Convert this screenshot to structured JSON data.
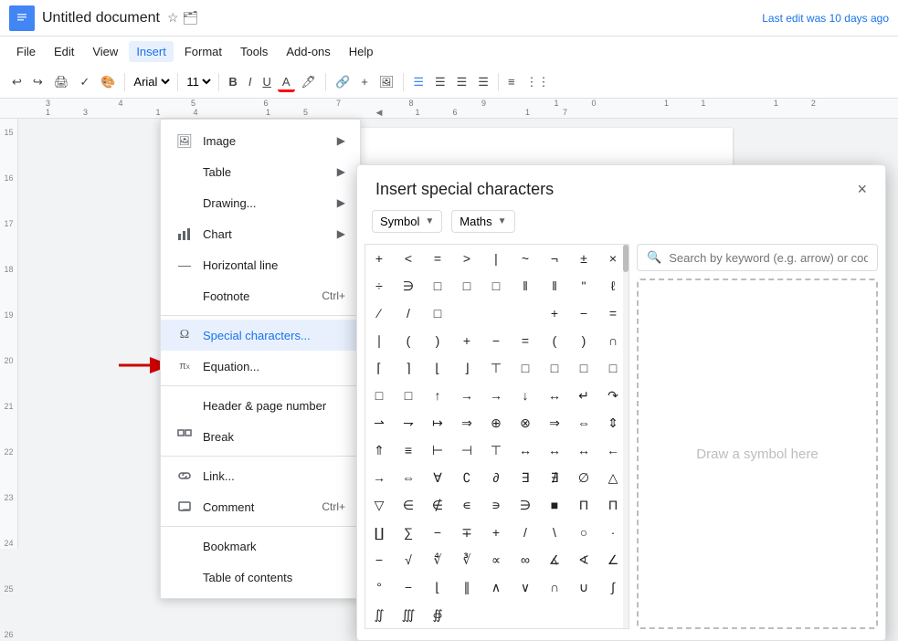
{
  "topbar": {
    "doc_icon": "📄",
    "title": "Untitled document",
    "star_icon": "☆",
    "folder_icon": "📁",
    "last_edit": "Last edit was 10 days ago"
  },
  "menubar": {
    "items": [
      "File",
      "Edit",
      "View",
      "Insert",
      "Format",
      "Tools",
      "Add-ons",
      "Help"
    ]
  },
  "toolbar": {
    "undo": "↩",
    "redo": "↪",
    "print": "🖨",
    "paint": "🎨",
    "font": "Arial",
    "font_size": "11",
    "bold": "B",
    "italic": "I",
    "underline": "U",
    "text_color": "A",
    "highlight": "🖊",
    "link": "🔗",
    "plus": "+",
    "image": "🖼"
  },
  "ruler": {
    "marks": [
      "3",
      "4",
      "5",
      "6",
      "7",
      "8",
      "9",
      "10",
      "11",
      "12",
      "13",
      "14",
      "15",
      "16",
      "17"
    ]
  },
  "sidebar": {
    "numbers": [
      "15",
      "16",
      "17",
      "18",
      "19",
      "20",
      "21",
      "22",
      "23",
      "24",
      "25",
      "26"
    ]
  },
  "dropdown": {
    "items": [
      {
        "id": "image",
        "icon": "🖼",
        "label": "Image",
        "has_arrow": true
      },
      {
        "id": "table",
        "icon": "",
        "label": "Table",
        "has_arrow": true
      },
      {
        "id": "drawing",
        "icon": "",
        "label": "Drawing...",
        "has_arrow": true
      },
      {
        "id": "chart",
        "icon": "📊",
        "label": "Chart",
        "has_arrow": true
      },
      {
        "id": "hline",
        "icon": "—",
        "label": "Horizontal line",
        "has_arrow": false
      },
      {
        "id": "footnote",
        "icon": "",
        "label": "Footnote",
        "shortcut": "Ctrl+",
        "has_arrow": false
      },
      {
        "id": "special",
        "icon": "Ω",
        "label": "Special characters...",
        "has_arrow": false,
        "highlighted": true
      },
      {
        "id": "equation",
        "icon": "π",
        "label": "Equation...",
        "has_arrow": false
      },
      {
        "id": "header",
        "icon": "",
        "label": "Header & page number",
        "has_arrow": false
      },
      {
        "id": "break",
        "icon": "⊞",
        "label": "Break",
        "has_arrow": false
      },
      {
        "id": "link",
        "icon": "🔗",
        "label": "Link...",
        "has_arrow": false
      },
      {
        "id": "comment",
        "icon": "💬",
        "label": "Comment",
        "shortcut": "Ctrl+",
        "has_arrow": false
      },
      {
        "id": "bookmark",
        "icon": "",
        "label": "Bookmark",
        "has_arrow": false
      },
      {
        "id": "toc",
        "icon": "",
        "label": "Table of contents",
        "has_arrow": false
      }
    ]
  },
  "dialog": {
    "title": "Insert special characters",
    "close_icon": "×",
    "dropdown1": "Symbol",
    "dropdown2": "Maths",
    "search_placeholder": "Search by keyword (e.g. arrow) or code point",
    "draw_text": "Draw a symbol here",
    "chars": [
      "+",
      "<",
      "=",
      ">",
      "|",
      "~",
      "¬",
      "±",
      "×",
      "÷",
      "∋",
      "□",
      "□",
      "□",
      "‖",
      "‖",
      "\"",
      "ℓ",
      "∕",
      "/",
      "□",
      " ",
      " ",
      " ",
      "+",
      "−",
      "=",
      "∣",
      "(",
      ")",
      "+",
      "−",
      "=",
      "(",
      ")",
      "∩",
      "⌈",
      "⌉",
      "⌊",
      "⌋",
      "⊤",
      "□",
      "□",
      "□",
      "□",
      "□",
      "□",
      "↑",
      "→",
      "→",
      "↓",
      "↔",
      "↵",
      "↷",
      "⇀",
      "⇁",
      "↦",
      "⇒",
      "⊕",
      "⊗",
      "⇒",
      "⇔",
      "⇕",
      "⇑",
      "≡",
      "⊢",
      "⊣",
      "⊤",
      "↔",
      "↔",
      "↔",
      "←",
      "→",
      "⇔",
      "∀",
      "∁",
      "∂",
      "∃",
      "∄",
      "∅",
      "△",
      "▽",
      "∈",
      "∉",
      "∊",
      "∍",
      "∋",
      "■",
      "Π",
      "Π",
      "∐",
      "∑",
      "−",
      "∓",
      "+",
      "/",
      "\\",
      "○",
      "·",
      "−",
      "√",
      "∜",
      "∛",
      "∝",
      "∞",
      "∡",
      "∢",
      "∠",
      "°",
      "−",
      "⌊",
      "∥",
      "∧",
      "∨",
      "∩",
      "∪",
      "∫",
      "∬",
      "∭",
      "∯"
    ]
  }
}
